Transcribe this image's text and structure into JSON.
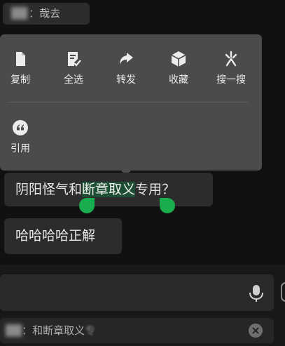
{
  "top_message": {
    "sender": "██",
    "separator": "：",
    "text": "哉去"
  },
  "context_menu": {
    "items": [
      {
        "label": "复制",
        "icon": "copy-icon"
      },
      {
        "label": "全选",
        "icon": "select-all-icon"
      },
      {
        "label": "转发",
        "icon": "forward-icon"
      },
      {
        "label": "收藏",
        "icon": "favorite-icon"
      },
      {
        "label": "搜一搜",
        "icon": "search-sparkle-icon"
      },
      {
        "label": "引用",
        "icon": "quote-icon"
      }
    ]
  },
  "selected_message": {
    "before": "阴阳怪气和",
    "selected": "断章取义",
    "after": "专用？"
  },
  "reply_message": {
    "text": "哈哈哈哈正解"
  },
  "quote_bar": {
    "sender": "██",
    "prefix": "：",
    "text": "和断章取义",
    "faded": "专"
  },
  "colors": {
    "background": "#111111",
    "menu": "#4b4b4b",
    "bubble": "#2c2c2c",
    "selection": "#1f4f33",
    "handle": "#1aad4d"
  }
}
